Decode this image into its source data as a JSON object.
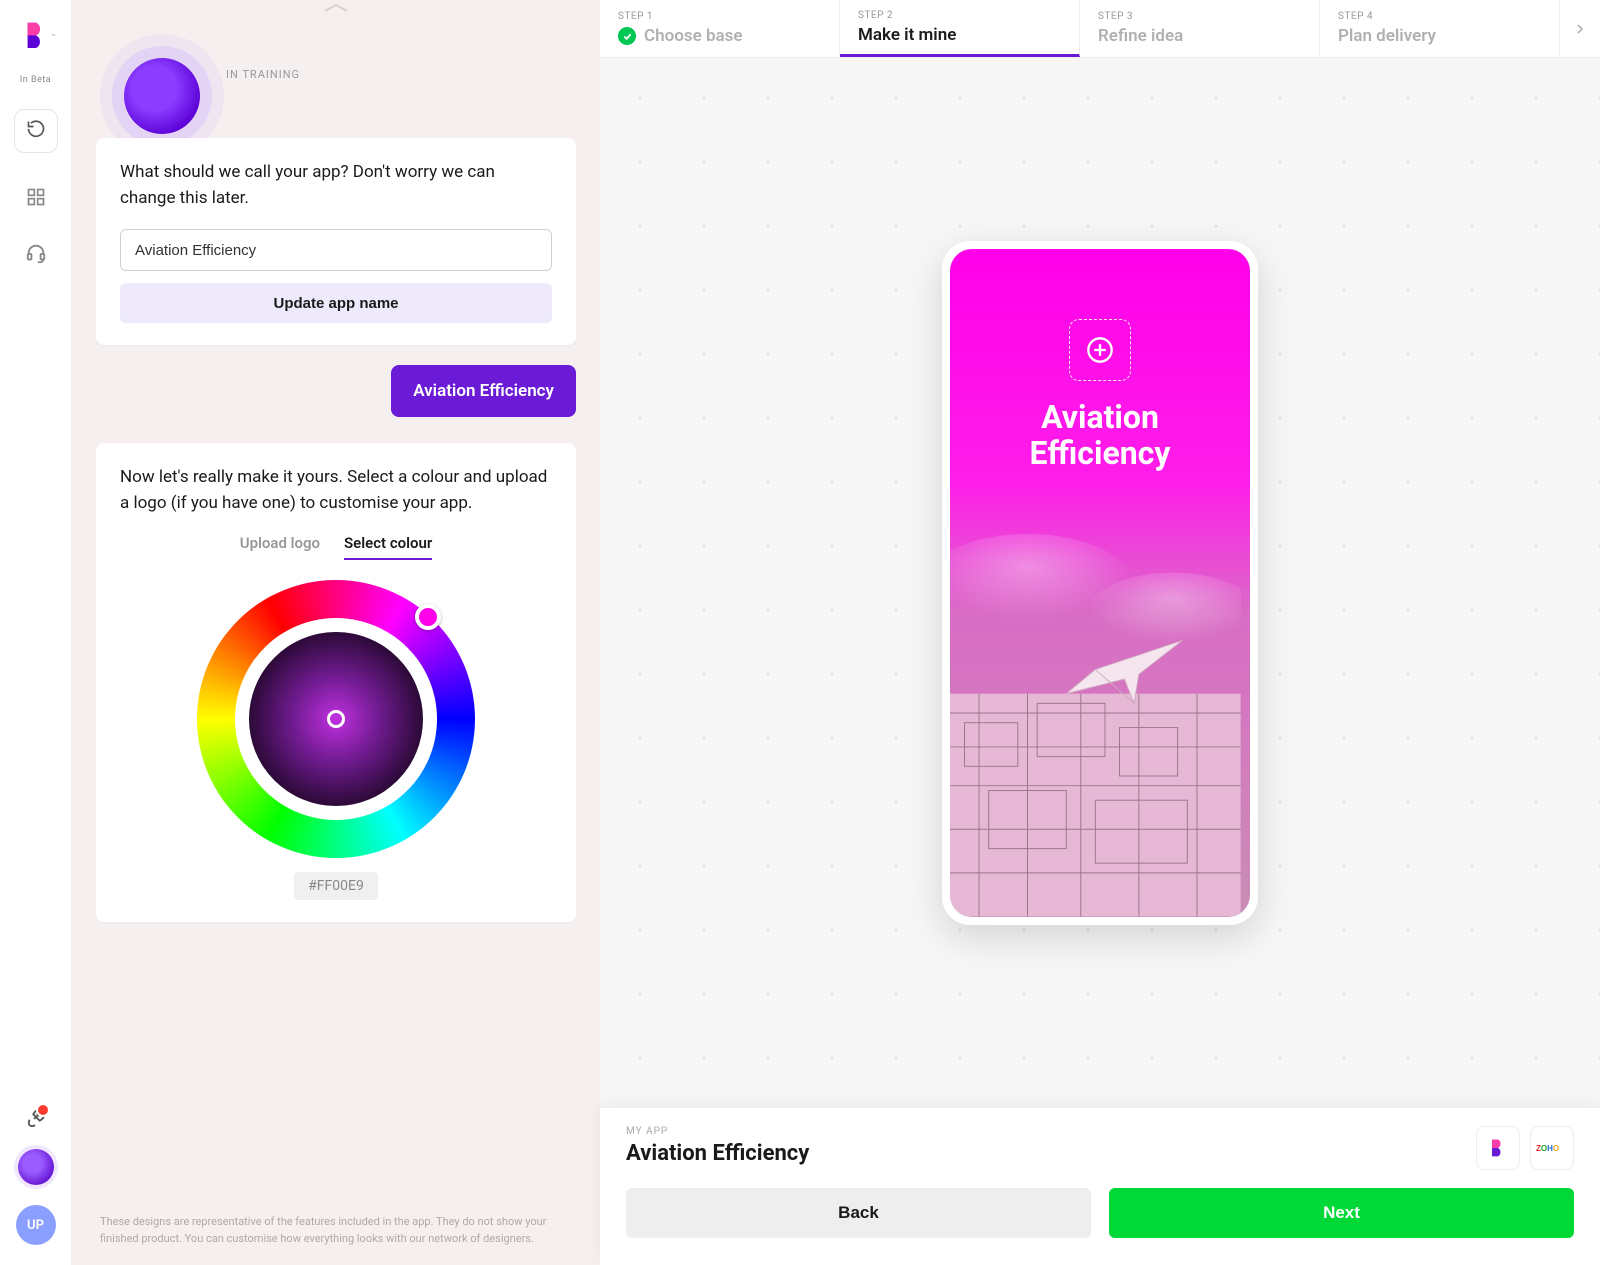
{
  "brand": {
    "beta_label": "In Beta"
  },
  "sidebar": {
    "undo_tooltip": "Undo",
    "avatar_initials": "UP"
  },
  "chat": {
    "training_label": "IN TRAINING",
    "card1_text": "What should we call your app? Don't worry we can change this later.",
    "name_field_value": "Aviation Efficiency",
    "update_btn": "Update app name",
    "user_bubble": "Aviation Efficiency",
    "card2_text": "Now let's really make it yours. Select a colour and upload a logo (if you have one) to customise your app.",
    "tabs": {
      "upload": "Upload logo",
      "select": "Select colour",
      "active": "select"
    },
    "hex": "#FF00E9",
    "disclaimer": "These designs are representative of the features included in the app. They do not show your finished product. You can customise how everything looks with our network of designers."
  },
  "stepper": {
    "steps": [
      {
        "num": "STEP 1",
        "title": "Choose base",
        "state": "completed"
      },
      {
        "num": "STEP 2",
        "title": "Make it mine",
        "state": "active"
      },
      {
        "num": "STEP 3",
        "title": "Refine idea",
        "state": "upcoming"
      },
      {
        "num": "STEP 4",
        "title": "Plan delivery",
        "state": "upcoming"
      }
    ]
  },
  "preview": {
    "app_name_line1": "Aviation",
    "app_name_line2": "Efficiency"
  },
  "footer": {
    "label": "MY APP",
    "name": "Aviation Efficiency",
    "back": "Back",
    "next": "Next"
  },
  "colors": {
    "accent": "#6b1bd6",
    "selected": "#FF00E9",
    "success": "#00d837"
  }
}
